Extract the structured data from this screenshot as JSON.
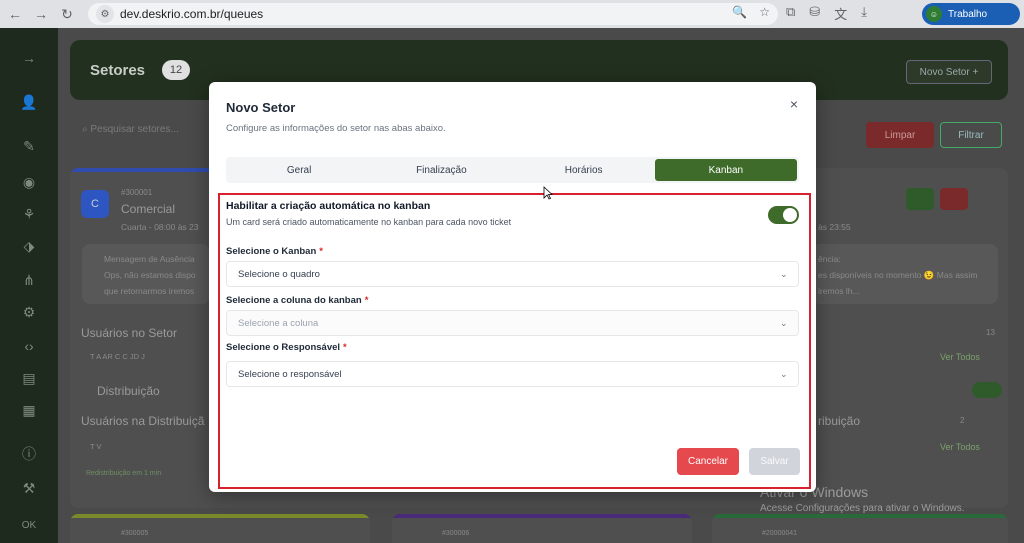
{
  "browser": {
    "url": "dev.deskrio.com.br/queues",
    "profile_label": "Trabalho"
  },
  "background": {
    "page_title": "Setores",
    "sector_count": "12",
    "new_sector_label": "Novo Setor  +",
    "search_placeholder": "Pesquisar setores...",
    "clear_label": "Limpar",
    "filter_label": "Filtrar",
    "card": {
      "id": "#300001",
      "name": "Comercial",
      "hours": "Cuarta - 08:00 às 23",
      "hours_right": "às 23:55",
      "absence_title": "Mensagem de Ausência",
      "absence_text_1": "Ops, não estamos dispo",
      "absence_text_2": "que retornarmos iremos",
      "absence_right_title": "ência:",
      "absence_right_1": "es disponíveis no momento 😉 Mas assim",
      "absence_right_2": "iremos lh...",
      "users_label": "Usuários no Setor",
      "users_count": "13",
      "users_initials": "T  A  AR  C  C  JD  J",
      "view_all": "Ver Todos",
      "distribution_label": "Distribuição",
      "users_distribution_label": "Usuários na Distribuiçã",
      "users_distribution_right": "ribuição",
      "distribution_count": "2",
      "distribution_initials": "T  V",
      "redistribution_badge": "Redistribuição em 1 min"
    },
    "cards_bottom": [
      "#300005",
      "#300006",
      "#20000041"
    ],
    "sidebar_bottom": "OK"
  },
  "modal": {
    "title": "Novo Setor",
    "subtitle": "Configure as informações do setor nas abas abaixo.",
    "close_symbol": "×",
    "tabs": [
      {
        "label": "Geral"
      },
      {
        "label": "Finalização"
      },
      {
        "label": "Horários"
      },
      {
        "label": "Kanban"
      }
    ],
    "active_tab": "Kanban",
    "kanban_toggle": {
      "title": "Habilitar a criação automática no kanban",
      "description": "Um card será criado automaticamente no kanban para cada novo ticket",
      "enabled": true
    },
    "fields": {
      "kanban": {
        "label": "Selecione o Kanban",
        "required": "*",
        "placeholder": "Selecione o quadro"
      },
      "column": {
        "label": "Selecione a coluna do kanban",
        "required": "*",
        "placeholder": "Selecione a coluna"
      },
      "responsible": {
        "label": "Selecione o Responsável",
        "required": "*",
        "placeholder": "Selecione o responsável"
      }
    },
    "cancel_label": "Cancelar",
    "save_label": "Salvar"
  },
  "windows": {
    "activate_title": "Ativar o Windows",
    "activate_text": "Acesse Configurações para ativar o Windows."
  },
  "colors": {
    "accent": "#3f6b2a",
    "cancel": "#e5484d",
    "highlight": "#d9202f"
  }
}
